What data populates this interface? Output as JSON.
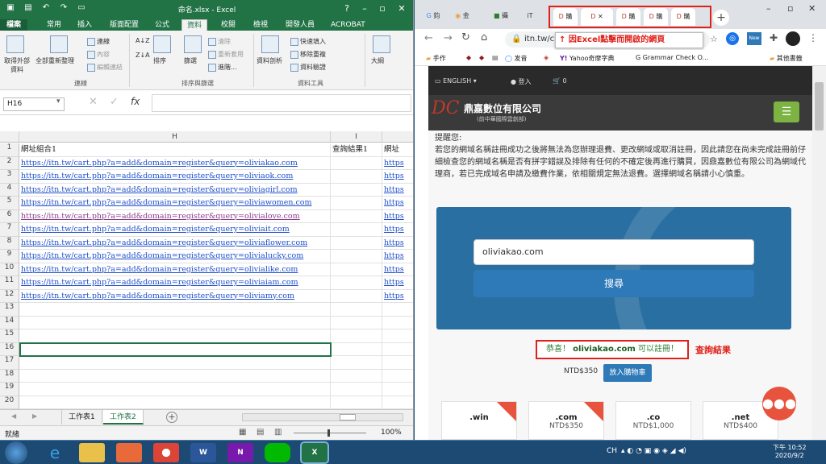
{
  "excel": {
    "title": "命名.xlsx - Excel",
    "tabs": [
      "檔案",
      "常用",
      "插入",
      "版面配置",
      "公式",
      "資料",
      "校閱",
      "檢視",
      "開發人員",
      "ACROBAT"
    ],
    "active_tab": "資料",
    "ribbon": {
      "get_external": "取得外部\n資料",
      "refresh_all": "全部重新整理",
      "connections": "連線",
      "properties": "內容",
      "edit_links": "編輯連結",
      "group_connections": "連線",
      "sort": "排序",
      "filter": "篩選",
      "clear": "清除",
      "reapply": "重新套用",
      "advanced": "進階...",
      "group_sort": "排序與篩選",
      "text_to_columns": "資料剖析",
      "flash_fill": "快速填入",
      "remove_dup": "移除重複",
      "validation": "資料驗證",
      "group_tools": "資料工具",
      "outline": "大綱"
    },
    "name_box": "H16",
    "columns": [
      "H",
      "I"
    ],
    "header_row": {
      "h": "網址組合1",
      "i": "查詢結果1",
      "j": "網址"
    },
    "rows": [
      "https://itn.tw/cart.php?a=add&domain=register&query=oliviakao.com",
      "https://itn.tw/cart.php?a=add&domain=register&query=oliviaok.com",
      "https://itn.tw/cart.php?a=add&domain=register&query=oliviagirl.com",
      "https://itn.tw/cart.php?a=add&domain=register&query=oliviawomen.com",
      "https://itn.tw/cart.php?a=add&domain=register&query=olivialove.com",
      "https://itn.tw/cart.php?a=add&domain=register&query=oliviait.com",
      "https://itn.tw/cart.php?a=add&domain=register&query=oliviaflower.com",
      "https://itn.tw/cart.php?a=add&domain=register&query=olivialucky.com",
      "https://itn.tw/cart.php?a=add&domain=register&query=olivialike.com",
      "https://itn.tw/cart.php?a=add&domain=register&query=oliviaiam.com",
      "https://itn.tw/cart.php?a=add&domain=register&query=oliviamy.com"
    ],
    "j_stub": "https",
    "row_numbers": [
      "1",
      "2",
      "3",
      "4",
      "5",
      "6",
      "7",
      "8",
      "9",
      "10",
      "11",
      "12",
      "13",
      "14",
      "15",
      "16",
      "17",
      "18",
      "19",
      "20"
    ],
    "sheets": [
      "工作表1",
      "工作表2"
    ],
    "status_ready": "就緒",
    "zoom": "100%"
  },
  "chrome": {
    "tabs_left": [
      "鈞",
      "金",
      "攝",
      "iT"
    ],
    "dc_tab_label": "購",
    "annotation": "↑ 因Excel點擊而開啟的網頁",
    "url": "itn.tw/c",
    "new_badge": "New",
    "bookmarks": [
      "手作",
      "发音",
      "Yahoo奇摩字典",
      "Grammar Check O...",
      "其他書籤"
    ],
    "site": {
      "english": "ENGLISH",
      "login": "登入",
      "cart_count": "0",
      "company": "鼎嘉數位有限公司",
      "company_sub": "(前中華國際雲創部)",
      "remind_title": "提醒您:",
      "remind_body": "若您的網域名稱註冊成功之後將無法為您辦理退費、更改網域或取消註冊，因此請您在尚未完成註冊前仔細檢查您的網域名稱是否有拼字錯誤及排除有任何的不確定後再進行購買，因鼎嘉數位有限公司為網域代理商，若已完成域名申請及繳費作業，依相關規定無法退費。選擇網域名稱請小心慎重。",
      "search_value": "oliviakao.com",
      "search_button": "搜尋",
      "result_prefix": "恭喜！",
      "result_domain": "oliviakao.com",
      "result_suffix": "可以註冊！",
      "result_label": "查詢結果",
      "price": "NTD$350",
      "add_cart": "放入購物車",
      "cards": [
        {
          "tld": ".win",
          "price": ""
        },
        {
          "tld": ".com",
          "price": "NTD$350"
        },
        {
          "tld": ".co",
          "price": "NTD$1,000"
        },
        {
          "tld": ".net",
          "price": "NTD$400"
        }
      ]
    }
  },
  "taskbar": {
    "ime": "CH",
    "time": "下午 10:52",
    "date": "2020/9/2"
  },
  "colors": {
    "excel_green": "#217346",
    "annotation_red": "#e0201a",
    "result_green": "#2e7d32",
    "search_blue": "#2e79b8"
  }
}
